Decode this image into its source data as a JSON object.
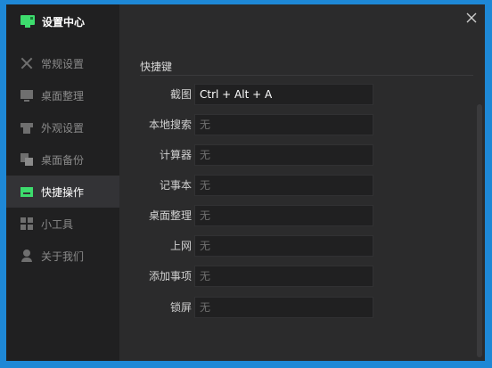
{
  "app": {
    "title": "设置中心",
    "logo_icon": "monitor-icon",
    "accent": "#3ddc6d"
  },
  "sidebar": {
    "items": [
      {
        "label": "常规设置",
        "icon": "tools-icon"
      },
      {
        "label": "桌面整理",
        "icon": "desktop-icon"
      },
      {
        "label": "外观设置",
        "icon": "shirt-icon"
      },
      {
        "label": "桌面备份",
        "icon": "backup-icon"
      },
      {
        "label": "快捷操作",
        "icon": "keyboard-icon",
        "active": true
      },
      {
        "label": "小工具",
        "icon": "widgets-icon"
      },
      {
        "label": "关于我们",
        "icon": "user-icon"
      }
    ]
  },
  "shortcuts": {
    "section_title": "快捷键",
    "rows": [
      {
        "label": "截图",
        "value": "Ctrl + Alt + A"
      },
      {
        "label": "本地搜索",
        "value": "无"
      },
      {
        "label": "计算器",
        "value": "无"
      },
      {
        "label": "记事本",
        "value": "无"
      },
      {
        "label": "桌面整理",
        "value": "无"
      },
      {
        "label": "上网",
        "value": "无"
      },
      {
        "label": "添加事项",
        "value": "无"
      },
      {
        "label": "锁屏",
        "value": "无"
      }
    ]
  }
}
